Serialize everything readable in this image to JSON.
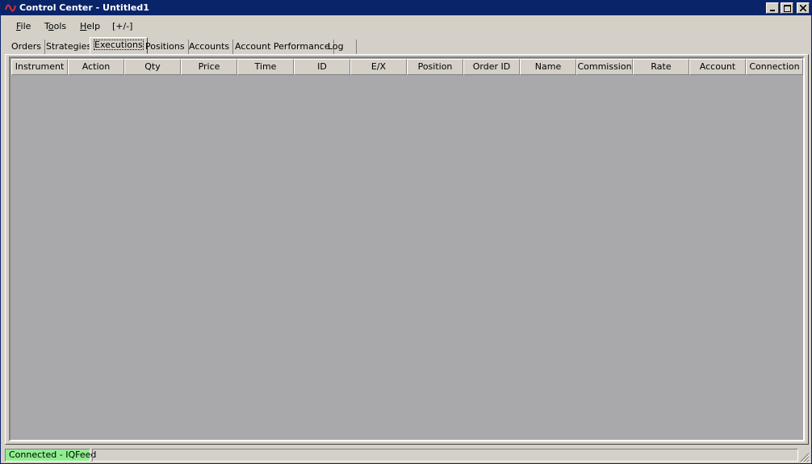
{
  "window": {
    "title": "Control Center - Untitled1",
    "buttons": {
      "minimize": "0",
      "maximize": "1",
      "close": "r"
    }
  },
  "menu": {
    "items": [
      {
        "mn": "F",
        "rest": "ile"
      },
      {
        "pre": "T",
        "mn": "o",
        "rest": "ols"
      },
      {
        "mn": "H",
        "rest": "elp"
      },
      {
        "label": "[+/-]"
      }
    ]
  },
  "tabs": [
    "Orders",
    "Strategies",
    "Executions",
    "Positions",
    "Accounts",
    "Account Performance",
    "Log"
  ],
  "active_tab": "Executions",
  "grid": {
    "columns": [
      "Instrument",
      "Action",
      "Qty",
      "Price",
      "Time",
      "ID",
      "E/X",
      "Position",
      "Order ID",
      "Name",
      "Commission",
      "Rate",
      "Account",
      "Connection"
    ],
    "rows": []
  },
  "status": {
    "connection": "Connected - IQFeed",
    "connection_color": "#90ee90"
  }
}
